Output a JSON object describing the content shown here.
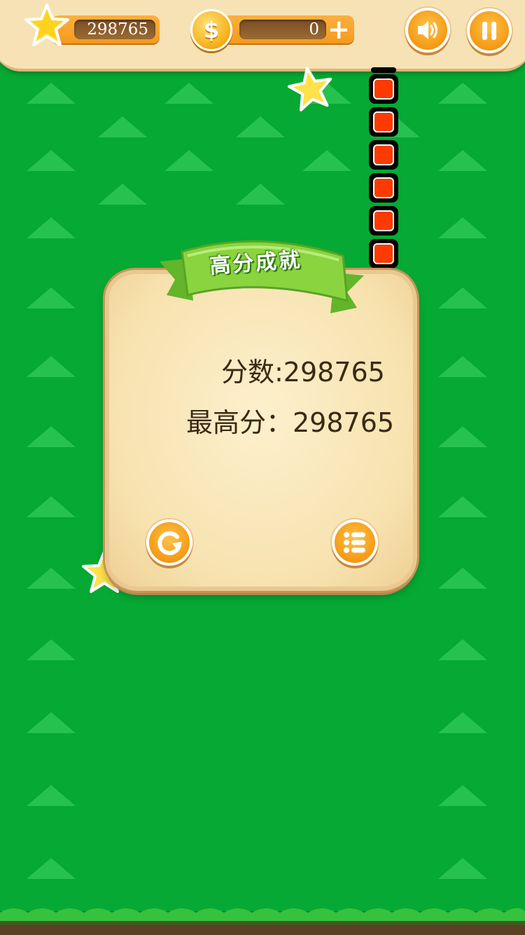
{
  "hud": {
    "score_value": "298765",
    "coin_value": "0",
    "coin_symbol": "$",
    "plus_label": "+",
    "icons": {
      "star": "star-icon",
      "coin": "coin-icon",
      "plus": "plus-icon",
      "sound": "speaker-icon",
      "pause": "pause-icon"
    }
  },
  "result_panel": {
    "title": "高分成就",
    "score_text": "分数:298765",
    "best_text": "最高分：298765",
    "restart_icon": "restart-icon",
    "menu_icon": "list-menu-icon"
  },
  "colors": {
    "background": "#05a933",
    "snake": "#ff3a00",
    "button": "#f59a14",
    "panel": "#f7e2af",
    "ribbon": "#8ad43f"
  }
}
